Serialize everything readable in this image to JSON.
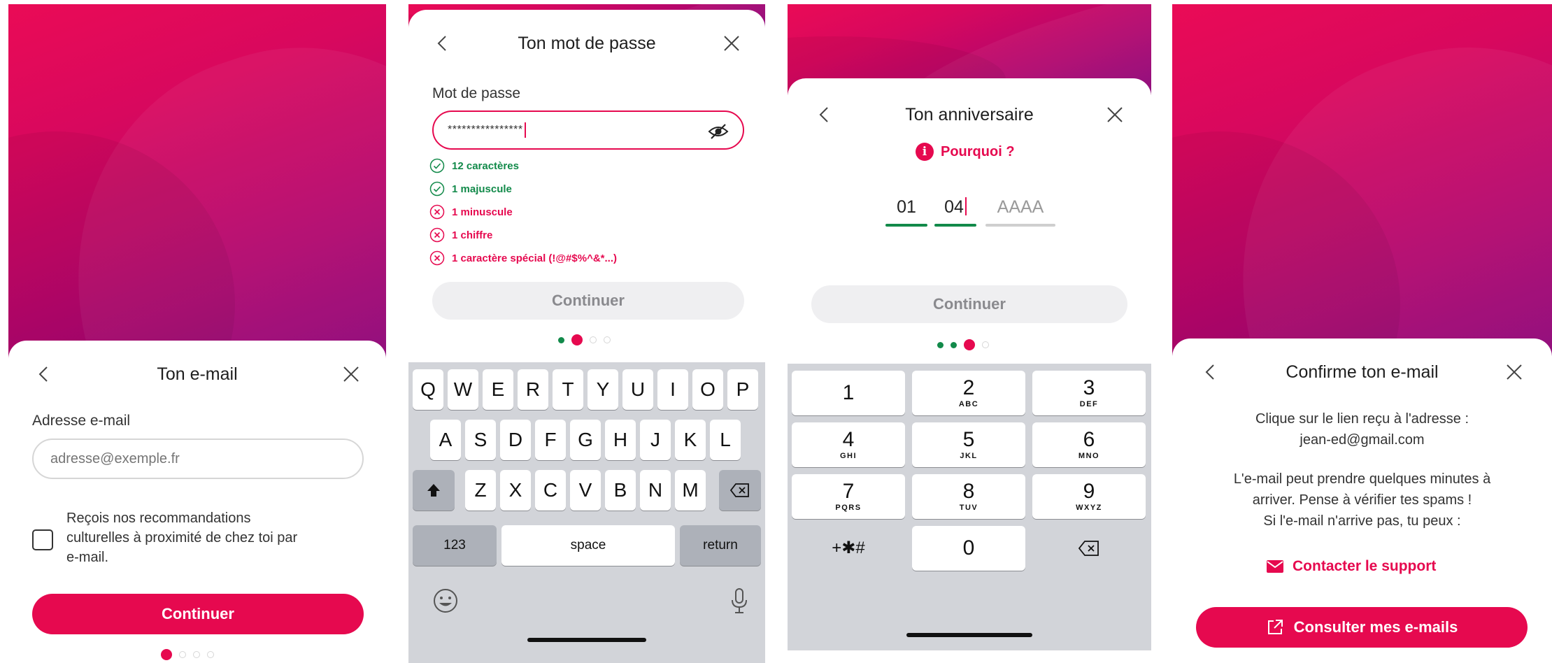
{
  "email_screen": {
    "title": "Ton e-mail",
    "field_label": "Adresse e-mail",
    "email_placeholder": "adresse@exemple.fr",
    "checkbox_text": [
      "Reçois nos recommandations",
      "culturelles à proximité de chez toi par",
      "e-mail."
    ],
    "checkbox_checked": false,
    "continue_label": "Continuer",
    "step": 1,
    "steps_total": 4
  },
  "password_screen": {
    "title": "Ton mot de passe",
    "field_label": "Mot de passe",
    "password_mask": "****************",
    "rules": [
      {
        "text": "12 caractères",
        "ok": true
      },
      {
        "text": "1 majuscule",
        "ok": true
      },
      {
        "text": "1 minuscule",
        "ok": false
      },
      {
        "text": "1 chiffre",
        "ok": false
      },
      {
        "text": "1 caractère spécial (!@#$%^&*...)",
        "ok": false
      }
    ],
    "continue_label": "Continuer",
    "step": 2,
    "steps_total": 4,
    "keyboard": {
      "row1": [
        "Q",
        "W",
        "E",
        "R",
        "T",
        "Y",
        "U",
        "I",
        "O",
        "P"
      ],
      "row2": [
        "A",
        "S",
        "D",
        "F",
        "G",
        "H",
        "J",
        "K",
        "L"
      ],
      "row3": [
        "Z",
        "X",
        "C",
        "V",
        "B",
        "N",
        "M"
      ],
      "numbers_key": "123",
      "space_key": "space",
      "return_key": "return"
    }
  },
  "birthday_screen": {
    "title": "Ton anniversaire",
    "why_label": "Pourquoi ?",
    "day": "01",
    "month": "04",
    "year_placeholder": "AAAA",
    "continue_label": "Continuer",
    "step": 3,
    "steps_total": 4,
    "numpad": [
      {
        "n": "1",
        "l": ""
      },
      {
        "n": "2",
        "l": "ABC"
      },
      {
        "n": "3",
        "l": "DEF"
      },
      {
        "n": "4",
        "l": "GHI"
      },
      {
        "n": "5",
        "l": "JKL"
      },
      {
        "n": "6",
        "l": "MNO"
      },
      {
        "n": "7",
        "l": "PQRS"
      },
      {
        "n": "8",
        "l": "TUV"
      },
      {
        "n": "9",
        "l": "WXYZ"
      }
    ],
    "symbols_key": "+✱#",
    "zero_key": "0"
  },
  "confirm_screen": {
    "title": "Confirme ton e-mail",
    "intro_line1": "Clique sur le lien reçu à l'adresse :",
    "email": "jean-ed@gmail.com",
    "info_line1": "L'e-mail peut prendre quelques minutes à",
    "info_line2": "arriver. Pense à vérifier tes spams !",
    "info_line3": "Si l'e-mail n'arrive pas, tu peux :",
    "support_label": "Contacter le support",
    "check_mail_label": "Consulter mes e-mails"
  },
  "colors": {
    "brand": "#e6094f",
    "success": "#128a4a",
    "gradient_end": "#8a0478"
  }
}
